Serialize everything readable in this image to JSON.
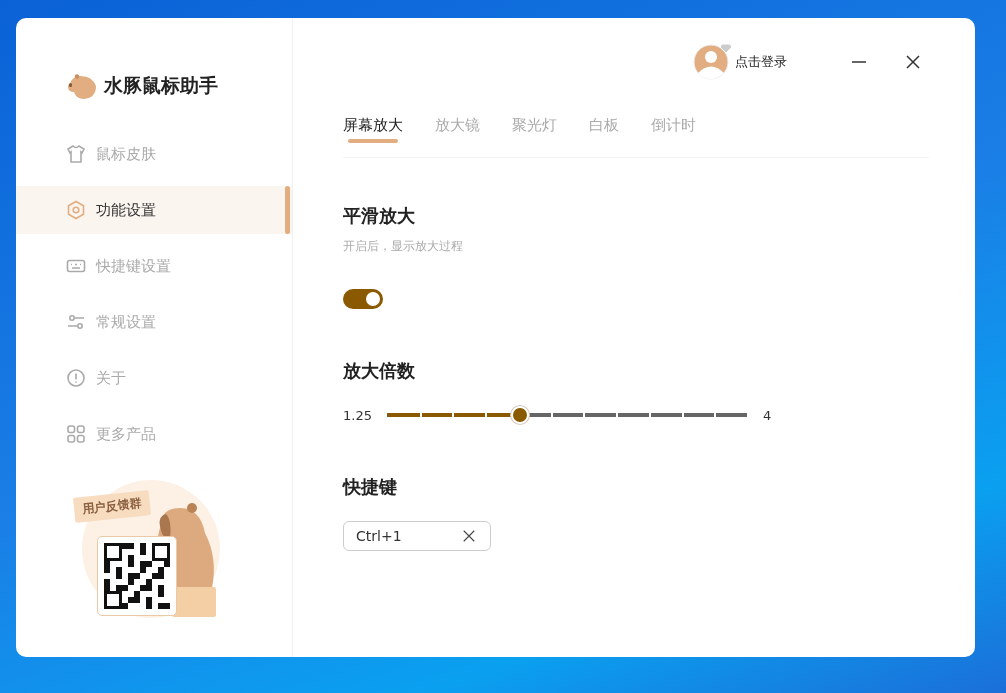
{
  "app": {
    "title": "水豚鼠标助手"
  },
  "sidebar": {
    "items": [
      {
        "label": "鼠标皮肤",
        "selected": false
      },
      {
        "label": "功能设置",
        "selected": true
      },
      {
        "label": "快捷键设置",
        "selected": false
      },
      {
        "label": "常规设置",
        "selected": false
      },
      {
        "label": "关于",
        "selected": false
      },
      {
        "label": "更多产品",
        "selected": false
      }
    ],
    "feedback": {
      "sign": "用户反馈群"
    }
  },
  "header": {
    "login": "点击登录"
  },
  "tabs": [
    {
      "label": "屏幕放大",
      "selected": true
    },
    {
      "label": "放大镜",
      "selected": false
    },
    {
      "label": "聚光灯",
      "selected": false
    },
    {
      "label": "白板",
      "selected": false
    },
    {
      "label": "倒计时",
      "selected": false
    }
  ],
  "smooth_zoom": {
    "title": "平滑放大",
    "description": "开启后，显示放大过程",
    "on": true
  },
  "zoom_factor": {
    "title": "放大倍数",
    "min": "1.25",
    "max": "4",
    "level": 0.364
  },
  "shortcut": {
    "title": "快捷键",
    "value": "Ctrl+1"
  }
}
